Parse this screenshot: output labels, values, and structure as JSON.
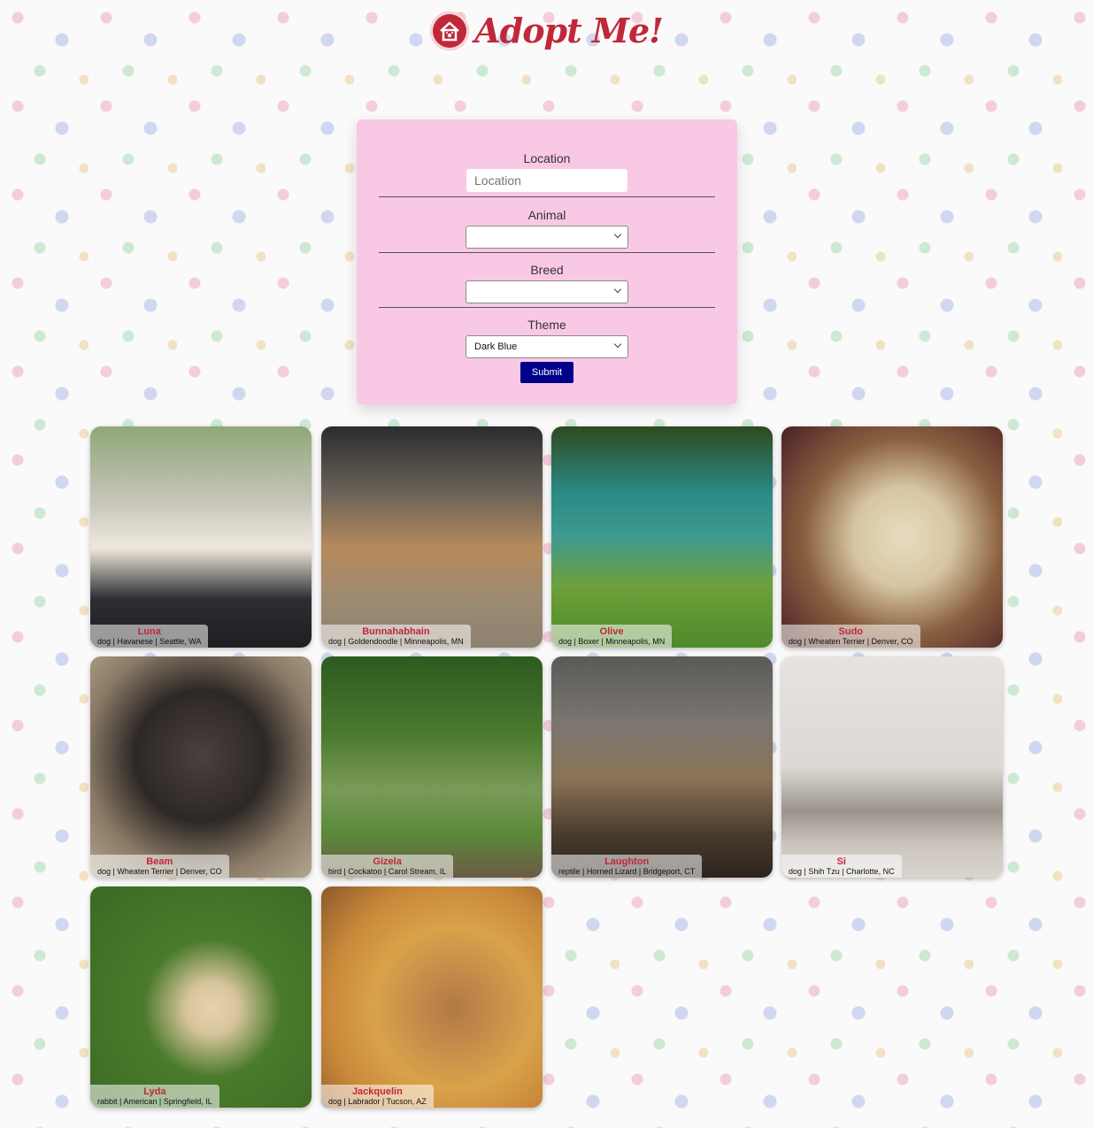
{
  "header": {
    "title": "Adopt Me!"
  },
  "search": {
    "location_label": "Location",
    "location_placeholder": "Location",
    "animal_label": "Animal",
    "animal_value": "",
    "breed_label": "Breed",
    "breed_value": "",
    "theme_label": "Theme",
    "theme_value": "Dark Blue",
    "submit_label": "Submit"
  },
  "colors": {
    "brand": "#c0283a",
    "panel": "#f9c8e4",
    "submit": "#00008b"
  },
  "pets": [
    {
      "name": "Luna",
      "desc": "dog | Havanese | Seattle, WA"
    },
    {
      "name": "Bunnahabhain",
      "desc": "dog | Goldendoodle | Minneapolis, MN"
    },
    {
      "name": "Olive",
      "desc": "dog | Boxer | Minneapolis, MN"
    },
    {
      "name": "Sudo",
      "desc": "dog | Wheaten Terrier | Denver, CO"
    },
    {
      "name": "Beam",
      "desc": "dog | Wheaten Terrier | Denver, CO"
    },
    {
      "name": "Gizela",
      "desc": "bird | Cockatoo | Carol Stream, IL"
    },
    {
      "name": "Laughton",
      "desc": "reptile | Horned Lizard | Bridgeport, CT"
    },
    {
      "name": "Si",
      "desc": "dog | Shih Tzu | Charlotte, NC"
    },
    {
      "name": "Lyda",
      "desc": "rabbit | American | Springfield, IL"
    },
    {
      "name": "Jackquelin",
      "desc": "dog | Labrador | Tucson, AZ"
    }
  ]
}
